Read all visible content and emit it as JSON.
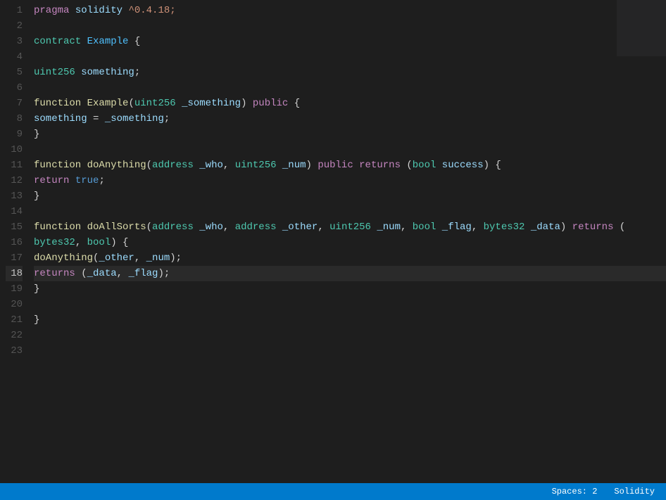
{
  "editor": {
    "background": "#1e1e1e",
    "active_line": 18,
    "lines": [
      {
        "num": 1,
        "tokens": [
          {
            "text": "pragma",
            "class": "kw-pragma"
          },
          {
            "text": " ",
            "class": "plain"
          },
          {
            "text": "solidity",
            "class": "kw-solidity"
          },
          {
            "text": " ^0.4.18;",
            "class": "kw-version"
          }
        ]
      },
      {
        "num": 2,
        "tokens": []
      },
      {
        "num": 3,
        "tokens": [
          {
            "text": "contract",
            "class": "kw-contract"
          },
          {
            "text": " ",
            "class": "plain"
          },
          {
            "text": "Example",
            "class": "kw-name"
          },
          {
            "text": " {",
            "class": "punc"
          }
        ]
      },
      {
        "num": 4,
        "tokens": []
      },
      {
        "num": 5,
        "tokens": [
          {
            "text": "    ",
            "class": "plain"
          },
          {
            "text": "uint256",
            "class": "kw-uint256"
          },
          {
            "text": " ",
            "class": "plain"
          },
          {
            "text": "something",
            "class": "var-name"
          },
          {
            "text": ";",
            "class": "punc"
          }
        ]
      },
      {
        "num": 6,
        "tokens": []
      },
      {
        "num": 7,
        "tokens": [
          {
            "text": "    ",
            "class": "plain"
          },
          {
            "text": "function",
            "class": "kw-function"
          },
          {
            "text": " ",
            "class": "plain"
          },
          {
            "text": "Example",
            "class": "fn-call"
          },
          {
            "text": "(",
            "class": "punc"
          },
          {
            "text": "uint256",
            "class": "kw-uint256"
          },
          {
            "text": " ",
            "class": "plain"
          },
          {
            "text": "_something",
            "class": "param"
          },
          {
            "text": ") ",
            "class": "punc"
          },
          {
            "text": "public",
            "class": "kw-public"
          },
          {
            "text": " {",
            "class": "punc"
          }
        ]
      },
      {
        "num": 8,
        "tokens": [
          {
            "text": "        ",
            "class": "plain"
          },
          {
            "text": "something",
            "class": "var-name"
          },
          {
            "text": " = ",
            "class": "plain"
          },
          {
            "text": "_something",
            "class": "param"
          },
          {
            "text": ";",
            "class": "punc"
          }
        ]
      },
      {
        "num": 9,
        "tokens": [
          {
            "text": "    }",
            "class": "punc"
          }
        ]
      },
      {
        "num": 10,
        "tokens": []
      },
      {
        "num": 11,
        "tokens": [
          {
            "text": "    ",
            "class": "plain"
          },
          {
            "text": "function",
            "class": "kw-function"
          },
          {
            "text": " ",
            "class": "plain"
          },
          {
            "text": "doAnything",
            "class": "fn-call"
          },
          {
            "text": "(",
            "class": "punc"
          },
          {
            "text": "address",
            "class": "kw-address"
          },
          {
            "text": " ",
            "class": "plain"
          },
          {
            "text": "_who",
            "class": "param"
          },
          {
            "text": ", ",
            "class": "punc"
          },
          {
            "text": "uint256",
            "class": "kw-uint256"
          },
          {
            "text": " ",
            "class": "plain"
          },
          {
            "text": "_num",
            "class": "param"
          },
          {
            "text": ") ",
            "class": "punc"
          },
          {
            "text": "public",
            "class": "kw-public"
          },
          {
            "text": " ",
            "class": "plain"
          },
          {
            "text": "returns",
            "class": "kw-returns"
          },
          {
            "text": " (",
            "class": "punc"
          },
          {
            "text": "bool",
            "class": "kw-bool"
          },
          {
            "text": " ",
            "class": "plain"
          },
          {
            "text": "success",
            "class": "param"
          },
          {
            "text": ") {",
            "class": "punc"
          }
        ]
      },
      {
        "num": 12,
        "tokens": [
          {
            "text": "        ",
            "class": "plain"
          },
          {
            "text": "return",
            "class": "kw-return"
          },
          {
            "text": " ",
            "class": "plain"
          },
          {
            "text": "true",
            "class": "kw-true"
          },
          {
            "text": ";",
            "class": "punc"
          }
        ]
      },
      {
        "num": 13,
        "tokens": [
          {
            "text": "    }",
            "class": "punc"
          }
        ]
      },
      {
        "num": 14,
        "tokens": []
      },
      {
        "num": 15,
        "tokens": [
          {
            "text": "    ",
            "class": "plain"
          },
          {
            "text": "function",
            "class": "kw-function"
          },
          {
            "text": " ",
            "class": "plain"
          },
          {
            "text": "doAllSorts",
            "class": "fn-call"
          },
          {
            "text": "(",
            "class": "punc"
          },
          {
            "text": "address",
            "class": "kw-address"
          },
          {
            "text": " ",
            "class": "plain"
          },
          {
            "text": "_who",
            "class": "param"
          },
          {
            "text": ", ",
            "class": "punc"
          },
          {
            "text": "address",
            "class": "kw-address"
          },
          {
            "text": " ",
            "class": "plain"
          },
          {
            "text": "_other",
            "class": "param"
          },
          {
            "text": ", ",
            "class": "punc"
          },
          {
            "text": "uint256",
            "class": "kw-uint256"
          },
          {
            "text": " ",
            "class": "plain"
          },
          {
            "text": "_num",
            "class": "param"
          },
          {
            "text": ", ",
            "class": "punc"
          },
          {
            "text": "bool",
            "class": "kw-bool"
          },
          {
            "text": " ",
            "class": "plain"
          },
          {
            "text": "_flag",
            "class": "param"
          },
          {
            "text": ", ",
            "class": "punc"
          },
          {
            "text": "bytes32",
            "class": "kw-bytes32"
          },
          {
            "text": " ",
            "class": "plain"
          },
          {
            "text": "_data",
            "class": "param"
          },
          {
            "text": ") ",
            "class": "punc"
          },
          {
            "text": "returns",
            "class": "kw-returns"
          },
          {
            "text": " (",
            "class": "punc"
          }
        ]
      },
      {
        "num": 16,
        "tokens": [
          {
            "text": "        ",
            "class": "plain"
          },
          {
            "text": "bytes32",
            "class": "kw-bytes32"
          },
          {
            "text": ", ",
            "class": "punc"
          },
          {
            "text": "bool",
            "class": "kw-bool"
          },
          {
            "text": ") {",
            "class": "punc"
          }
        ]
      },
      {
        "num": 17,
        "tokens": [
          {
            "text": "        ",
            "class": "plain"
          },
          {
            "text": "doAnything",
            "class": "fn-call"
          },
          {
            "text": "(",
            "class": "punc"
          },
          {
            "text": "_other",
            "class": "param"
          },
          {
            "text": ", ",
            "class": "punc"
          },
          {
            "text": "_num",
            "class": "param"
          },
          {
            "text": ");",
            "class": "punc"
          }
        ]
      },
      {
        "num": 18,
        "tokens": [
          {
            "text": "        ",
            "class": "plain"
          },
          {
            "text": "returns",
            "class": "kw-returns"
          },
          {
            "text": " (",
            "class": "punc"
          },
          {
            "text": "_data",
            "class": "param"
          },
          {
            "text": ", ",
            "class": "punc"
          },
          {
            "text": "_flag",
            "class": "param"
          },
          {
            "text": ");",
            "class": "punc"
          }
        ]
      },
      {
        "num": 19,
        "tokens": [
          {
            "text": "    }",
            "class": "punc"
          }
        ]
      },
      {
        "num": 20,
        "tokens": []
      },
      {
        "num": 21,
        "tokens": [
          {
            "text": "}",
            "class": "punc"
          }
        ]
      },
      {
        "num": 22,
        "tokens": []
      },
      {
        "num": 23,
        "tokens": []
      }
    ]
  },
  "status_bar": {
    "spaces_label": "Spaces: 2",
    "language_label": "Solidity"
  }
}
